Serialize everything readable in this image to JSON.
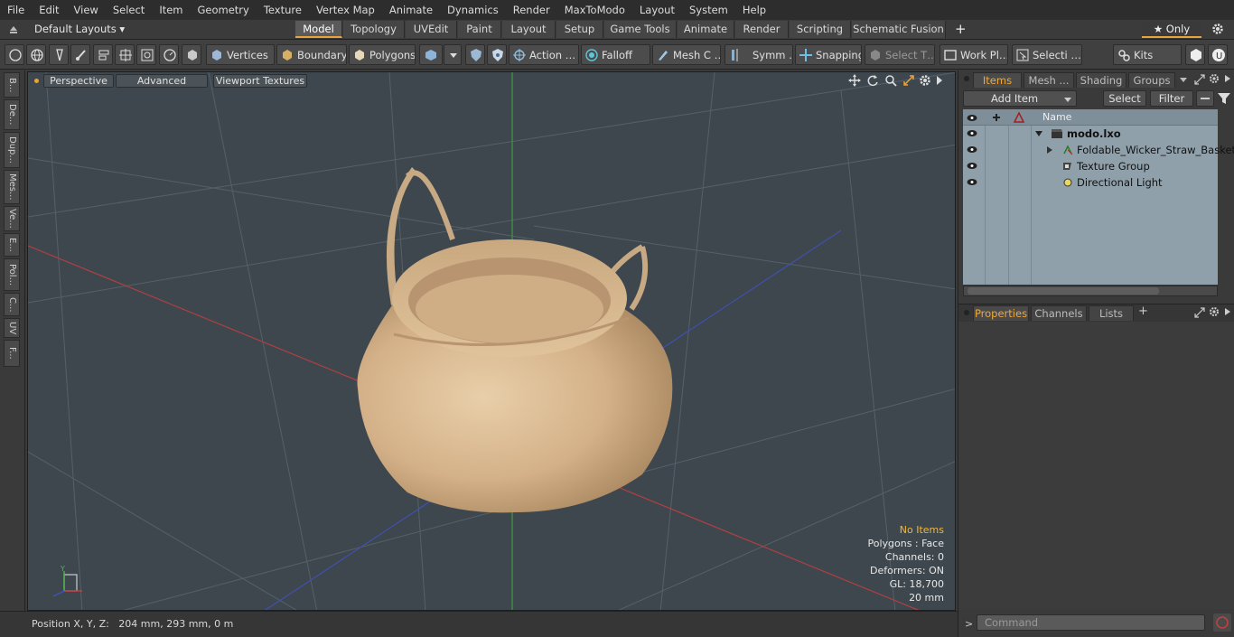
{
  "menu": [
    "File",
    "Edit",
    "View",
    "Select",
    "Item",
    "Geometry",
    "Texture",
    "Vertex Map",
    "Animate",
    "Dynamics",
    "Render",
    "MaxToModo",
    "Layout",
    "System",
    "Help"
  ],
  "layout_selector": "Default Layouts ▾",
  "tabs": [
    "Model",
    "Topology",
    "UVEdit",
    "Paint",
    "Layout",
    "Setup",
    "Game Tools",
    "Animate",
    "Render",
    "Scripting",
    "Schematic Fusion"
  ],
  "add_tab": "+",
  "only_label": "★ Only",
  "toolbar": {
    "vertices": "Vertices",
    "boundary": "Boundary",
    "polygons": "Polygons",
    "action": "Action …",
    "falloff": "Falloff",
    "mesh": "Mesh C …",
    "symm": "Symm …",
    "snapping": "Snapping",
    "select_t": "Select T…",
    "work_pl": "Work Pl…",
    "selecti": "Selecti …",
    "kits": "Kits"
  },
  "left_tabs": [
    "B...",
    "De...",
    "Dup...",
    "Mes...",
    "Ve...",
    "E...",
    "Pol...",
    "C...",
    "UV",
    "F..."
  ],
  "viewport": {
    "perspective": "Perspective",
    "advanced": "Advanced",
    "viewport_textures": "Viewport Textures",
    "info": {
      "no_items": "No Items",
      "polygons": "Polygons : Face",
      "channels": "Channels: 0",
      "deformers": "Deformers: ON",
      "gl": "GL: 18,700",
      "scale": "20 mm"
    }
  },
  "status": {
    "position": "Position X, Y, Z:   204 mm, 293 mm, 0 m"
  },
  "items_panel": {
    "tabs": [
      "Items",
      "Mesh ...",
      "Shading",
      "Groups"
    ],
    "add_item": "Add Item",
    "select": "Select",
    "filter": "Filter",
    "column_name": "Name",
    "tree": [
      {
        "label": "modo.lxo",
        "bold": true
      },
      {
        "label": "Foldable_Wicker_Straw_Basket"
      },
      {
        "label": "Texture Group"
      },
      {
        "label": "Directional Light"
      }
    ]
  },
  "props_panel": {
    "tabs": [
      "Properties",
      "Channels",
      "Lists"
    ],
    "add": "+"
  },
  "command": {
    "placeholder": "Command"
  },
  "colors": {
    "accent": "#e8a33a",
    "viewport_bg": "#3e474e",
    "basket": "#d8b68c"
  }
}
